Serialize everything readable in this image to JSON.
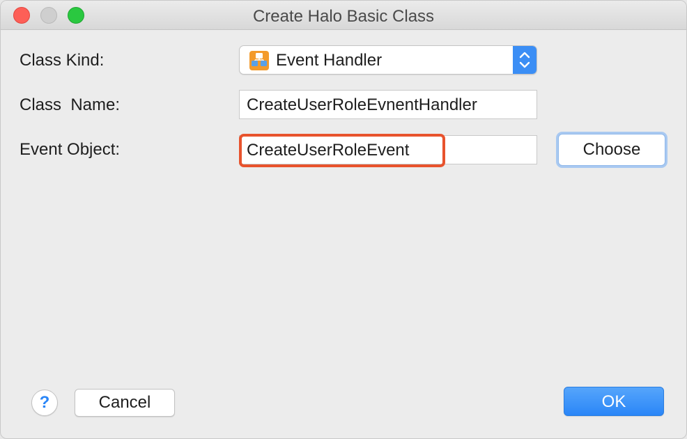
{
  "window": {
    "title": "Create Halo Basic Class"
  },
  "form": {
    "class_kind": {
      "label": "Class Kind:",
      "selected": "Event Handler",
      "icon": "event-handler-icon"
    },
    "class_name": {
      "label": "Class  Name:",
      "value": "CreateUserRoleEvnentHandler"
    },
    "event_object": {
      "label": "Event Object:",
      "value": "CreateUserRoleEvent",
      "choose_label": "Choose"
    }
  },
  "footer": {
    "help_label": "?",
    "cancel_label": "Cancel",
    "ok_label": "OK"
  },
  "colors": {
    "accent": "#2a86f7",
    "highlight": "#e8532d"
  }
}
